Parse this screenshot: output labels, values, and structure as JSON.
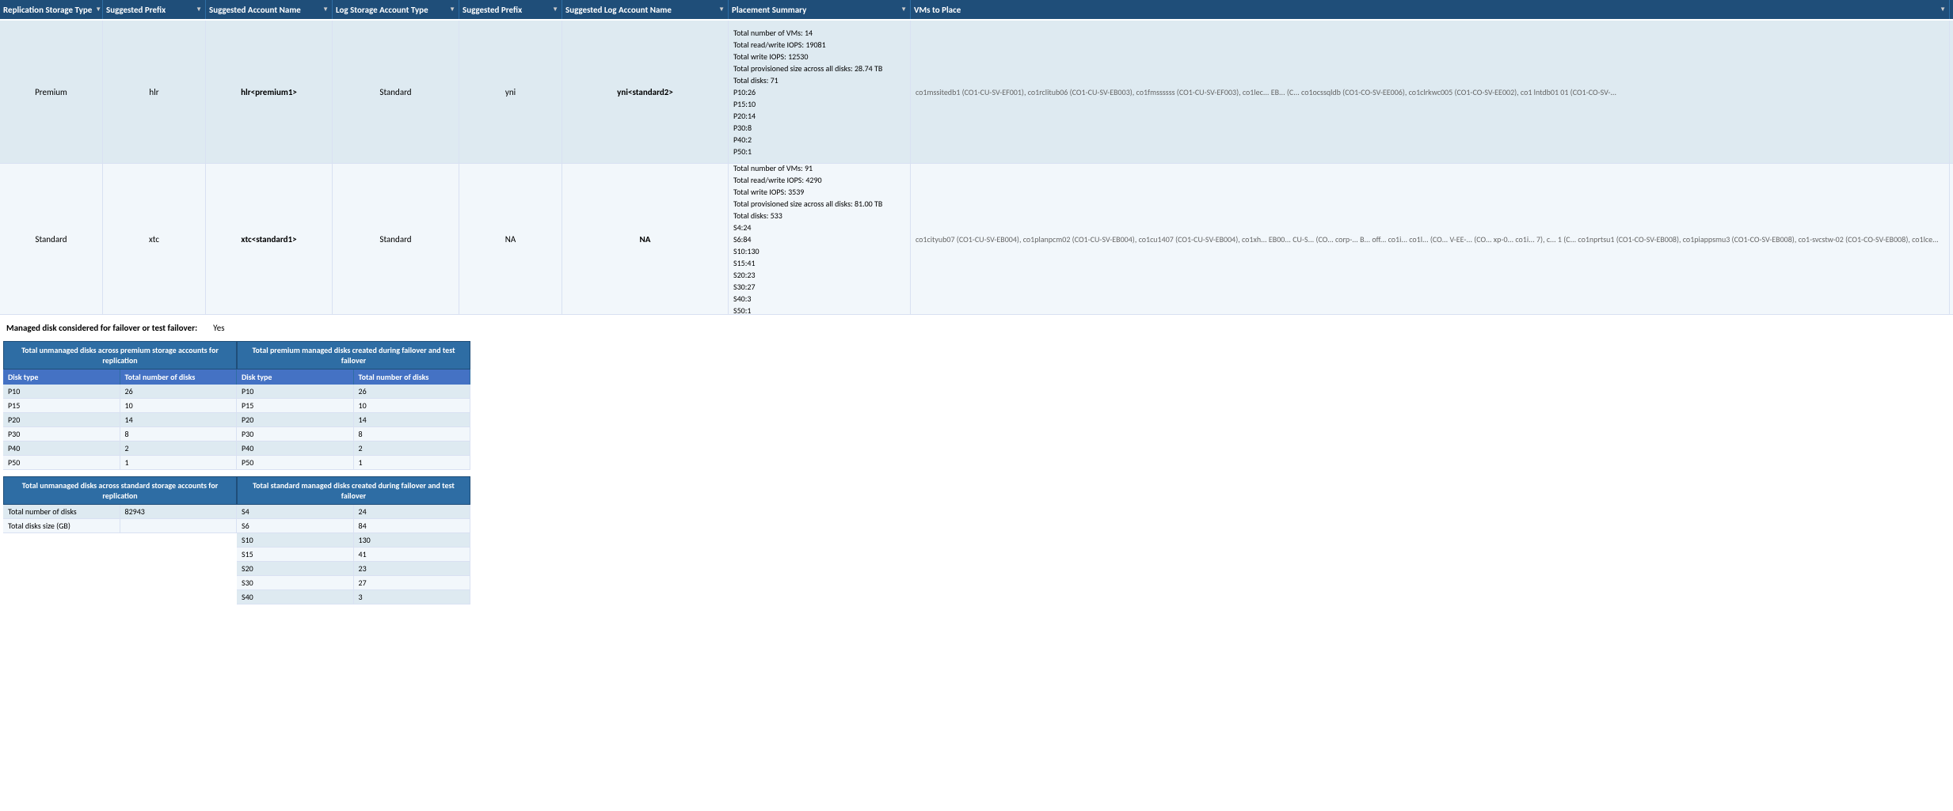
{
  "header": {
    "columns": [
      {
        "label": "Replication Storage Type",
        "key": "col-replication"
      },
      {
        "label": "Suggested Prefix",
        "key": "col-prefix"
      },
      {
        "label": "Suggested Account Name",
        "key": "col-account-name"
      },
      {
        "label": "Log Storage Account Type",
        "key": "col-log-storage"
      },
      {
        "label": "Suggested Prefix",
        "key": "col-log-prefix"
      },
      {
        "label": "Suggested Log Account  Name",
        "key": "col-log-account-name"
      },
      {
        "label": "Placement Summary",
        "key": "col-placement"
      },
      {
        "label": "VMs to Place",
        "key": "col-vms"
      }
    ]
  },
  "rows": [
    {
      "type": "premium",
      "replication": "Premium",
      "prefix": "hlr",
      "accountName": "hlr<premium1>",
      "logStorage": "Standard",
      "logPrefix": "yni",
      "logAccountName": "yni<standard2>",
      "placement": "Total number of VMs: 14\nTotal read/write IOPS: 19081\nTotal write IOPS: 12530\nTotal provisioned size across all disks: 28.74 TB\nTotal disks: 71\nP10:26\nP15:10\nP20:14\nP30:8\nP40:2\nP50:1",
      "vms": "co1mssitedb1 (CO1-CU-SV-EF001), co1rclitub06 (CO1-CU-SV-EB003), co1fmssssss (CO1-CU-SV-EF003), co1lec... EB... (C... co1ocssqldb (CO1-CO-SV-EE006), co1clrkwc005 (CO1-CO-SV-EE002), co1 lntdb01 01 (CO1-CO-SV-..."
    },
    {
      "type": "standard",
      "replication": "Standard",
      "prefix": "xtc",
      "accountName": "xtc<standard1>",
      "logStorage": "Standard",
      "logPrefix": "NA",
      "logAccountName": "NA",
      "placement": "Total number of VMs: 91\nTotal read/write IOPS: 4290\nTotal write IOPS: 3539\nTotal provisioned size across all disks: 81.00 TB\nTotal disks: 533\nS4:24\nS6:84\nS10:130\nS15:41\nS20:23\nS30:27\nS40:3\nS50:1",
      "vms": "co1cityub07 (CO1-CU-SV-EB004), co1planpcm02 (CO1-CU-SV-EB004), co1cu1407 (CO1-CU-SV-EB004), co1xh... EB00... CU-S... (CO... corp-... B... off... co1i... co1l... (CO... V-EE-... (CO... xp-0... co1i... 7), c... 1 (C... co1nprtsu1 (CO1-CO-SV-EB008), co1piappsmu3 (CO1-CO-SV-EB008), co1-svcstw-02 (CO1-CO-SV-EB008), co1lce..."
    }
  ],
  "managed_disk": {
    "label": "Managed disk considered for failover or test failover:",
    "value": "Yes"
  },
  "premium_unmanaged_table": {
    "title": "Total  unmanaged disks across premium storage accounts for replication",
    "headers": [
      "Disk type",
      "Total number of disks"
    ],
    "rows": [
      {
        "type": "P10",
        "count": "26"
      },
      {
        "type": "P15",
        "count": "10"
      },
      {
        "type": "P20",
        "count": "14"
      },
      {
        "type": "P30",
        "count": "8"
      },
      {
        "type": "P40",
        "count": "2"
      },
      {
        "type": "P50",
        "count": "1"
      }
    ]
  },
  "premium_managed_table": {
    "title": "Total premium managed disks created during failover and test failover",
    "headers": [
      "Disk type",
      "Total number of disks"
    ],
    "rows": [
      {
        "type": "P10",
        "count": "26"
      },
      {
        "type": "P15",
        "count": "10"
      },
      {
        "type": "P20",
        "count": "14"
      },
      {
        "type": "P30",
        "count": "8"
      },
      {
        "type": "P40",
        "count": "2"
      },
      {
        "type": "P50",
        "count": "1"
      }
    ]
  },
  "standard_unmanaged_table": {
    "title": "Total unmanaged disks across standard storage accounts for replication",
    "rows": [
      {
        "label": "Total number of disks",
        "value": "82943"
      },
      {
        "label": "Total disks size (GB)",
        "value": ""
      }
    ]
  },
  "standard_managed_table": {
    "title": "Total standard managed disks created during failover and test failover",
    "rows": [
      {
        "type": "S4",
        "count": "24"
      },
      {
        "type": "S6",
        "count": "84"
      },
      {
        "type": "S10",
        "count": "130"
      },
      {
        "type": "S15",
        "count": "41"
      },
      {
        "type": "S20",
        "count": "23"
      },
      {
        "type": "S30",
        "count": "27"
      },
      {
        "type": "S40",
        "count": "3"
      }
    ]
  }
}
